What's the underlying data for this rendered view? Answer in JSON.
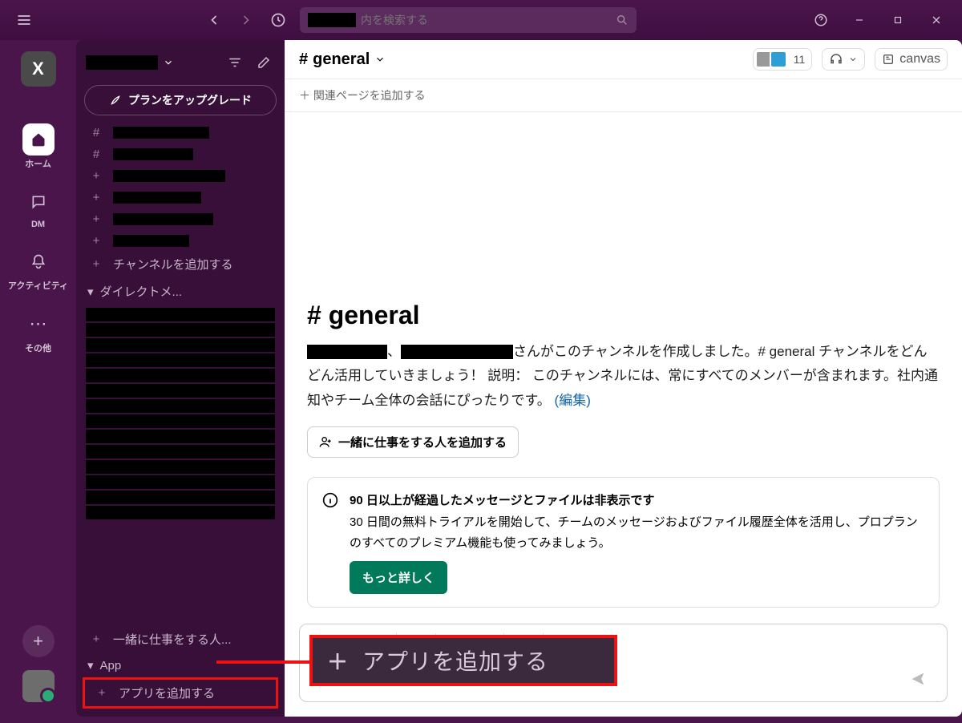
{
  "search": {
    "placeholder": "内を検索する"
  },
  "rail": {
    "workspace_letter": "X",
    "home": "ホーム",
    "dm": "DM",
    "activity": "アクティビティ",
    "more": "その他"
  },
  "sidebar": {
    "upgrade": "プランをアップグレード",
    "add_channel": "チャンネルを追加する",
    "dm_section": "ダイレクトメ...",
    "add_coworkers": "一緒に仕事をする人...",
    "app_section": "App",
    "add_apps": "アプリを追加する"
  },
  "channel": {
    "name": "general",
    "member_count": "11",
    "canvas": "canvas",
    "bookmark": "関連ページを追加する",
    "big_title": "# general",
    "desc_mid": "、",
    "desc_after": "さんがこのチャンネルを作成しました。# general チャンネルをどんどん活用していきましょう！ 説明： このチャンネルには、常にすべてのメンバーが含まれます。社内通知やチーム全体の会話にぴったりです。",
    "edit": "(編集)",
    "add_people": "一緒に仕事をする人を追加する",
    "info_title": "90 日以上が経過したメッセージとファイルは非表示です",
    "info_body": "30 日間の無料トライアルを開始して、チームのメッセージおよびファイル履歴全体を活用し、プロプランのすべてのプレミアム機能も使ってみましょう。",
    "more": "もっと詳しく"
  },
  "callout": {
    "label": "アプリを追加する"
  }
}
